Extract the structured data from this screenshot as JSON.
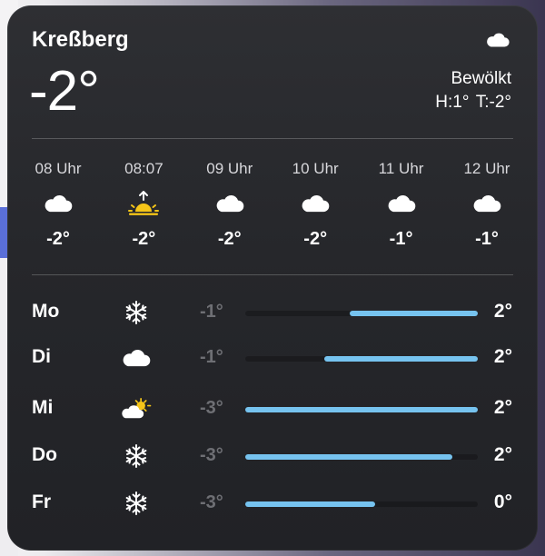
{
  "widget": {
    "city": "Kreßberg",
    "current_temp": "-2°",
    "current_icon": "cloud-icon",
    "condition": "Bewölkt",
    "high": "H:1°",
    "low": "T:-2°"
  },
  "hourly": [
    {
      "time": "08 Uhr",
      "icon": "cloud-icon",
      "temp": "-2°"
    },
    {
      "time": "08:07",
      "icon": "sunrise-icon",
      "temp": "-2°"
    },
    {
      "time": "09 Uhr",
      "icon": "cloud-icon",
      "temp": "-2°"
    },
    {
      "time": "10 Uhr",
      "icon": "cloud-icon",
      "temp": "-2°"
    },
    {
      "time": "11 Uhr",
      "icon": "cloud-icon",
      "temp": "-1°"
    },
    {
      "time": "12 Uhr",
      "icon": "cloud-icon",
      "temp": "-1°"
    }
  ],
  "daily": [
    {
      "day": "Mo",
      "icon": "snowflake-icon",
      "low": "-1°",
      "high": "2°",
      "range_start": 0.45,
      "range_end": 1.0
    },
    {
      "day": "Di",
      "icon": "cloud-icon",
      "low": "-1°",
      "high": "2°",
      "range_start": 0.34,
      "range_end": 1.0
    },
    {
      "day": "Mi",
      "icon": "sun-cloud-icon",
      "low": "-3°",
      "high": "2°",
      "range_start": 0.0,
      "range_end": 1.0
    },
    {
      "day": "Do",
      "icon": "snowflake-icon",
      "low": "-3°",
      "high": "2°",
      "range_start": 0.0,
      "range_end": 0.89
    },
    {
      "day": "Fr",
      "icon": "snowflake-icon",
      "low": "-3°",
      "high": "0°",
      "range_start": 0.0,
      "range_end": 0.56
    }
  ],
  "colors": {
    "range_fill": "#76c3ef",
    "sun_yellow": "#f5c518"
  }
}
